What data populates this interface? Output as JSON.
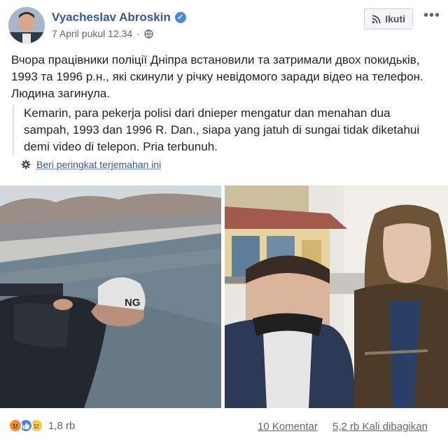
{
  "post": {
    "author": "Vyacheslav Abroskin",
    "timestamp": "7 April pukul 12.34",
    "follow_label": "Ikuti",
    "text": "Вчора працівники поліції Дніпра встановили та затримали двох покидьків, 1993 та 1996 р.н., які скинули у річку невідомого заради відео на телефон. Людина загинула.",
    "translation": "Kemarin, para pekerja polisi dari dnieper mengatur dan menahan dua sampah, 1993 dan 1996 R. Dan., siapa yang jatuh di sungai tidak diketahui demi video di telepon. Pria terbunuh.",
    "rate_translation_label": "Beri peringkat terjemahan ini"
  },
  "photos": {
    "left_cap_text": "NG"
  },
  "footer": {
    "reaction_count": "1,8 rb",
    "comments": "10 Komentar",
    "shares": "5,2 rb Kali dibagikan"
  },
  "icons": [
    "verified-badge-icon",
    "globe-icon",
    "rss-icon",
    "more-icon",
    "gear-icon",
    "angry-icon",
    "like-icon",
    "sad-icon"
  ]
}
